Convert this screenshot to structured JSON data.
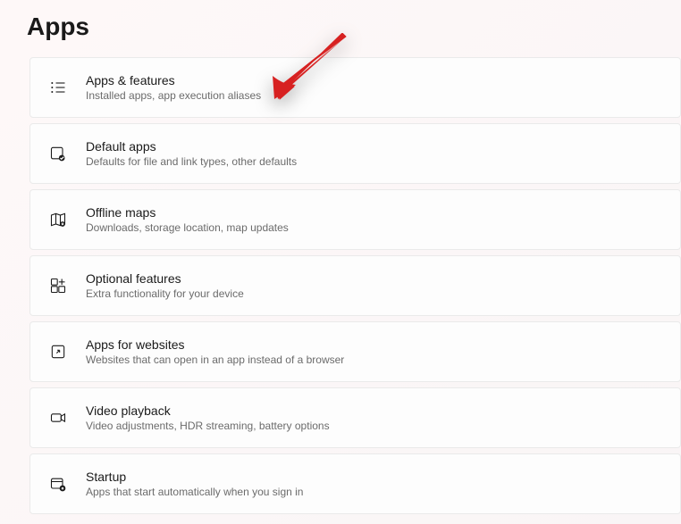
{
  "page": {
    "title": "Apps"
  },
  "items": [
    {
      "title": "Apps & features",
      "subtitle": "Installed apps, app execution aliases"
    },
    {
      "title": "Default apps",
      "subtitle": "Defaults for file and link types, other defaults"
    },
    {
      "title": "Offline maps",
      "subtitle": "Downloads, storage location, map updates"
    },
    {
      "title": "Optional features",
      "subtitle": "Extra functionality for your device"
    },
    {
      "title": "Apps for websites",
      "subtitle": "Websites that can open in an app instead of a browser"
    },
    {
      "title": "Video playback",
      "subtitle": "Video adjustments, HDR streaming, battery options"
    },
    {
      "title": "Startup",
      "subtitle": "Apps that start automatically when you sign in"
    }
  ]
}
